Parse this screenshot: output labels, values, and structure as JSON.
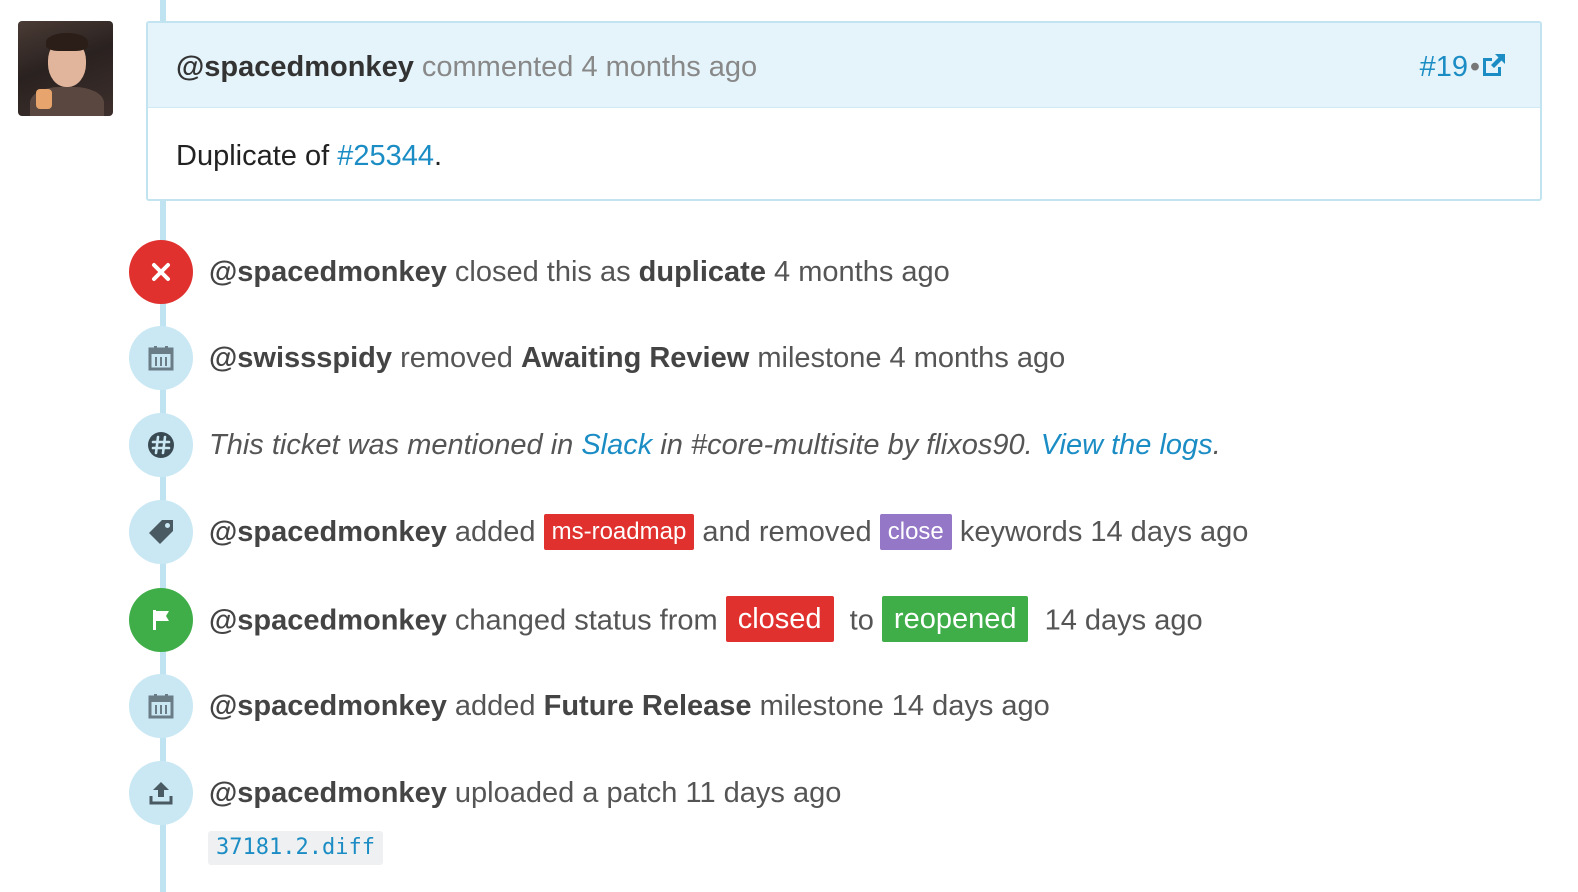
{
  "comment": {
    "author": "@spacedmonkey",
    "action": "commented 4 months ago",
    "number": "#19",
    "separator": "•",
    "body_prefix": "Duplicate of",
    "body_link": "#25344",
    "body_suffix": "."
  },
  "events": [
    {
      "icon": "close-icon",
      "parts": {
        "user": "@spacedmonkey",
        "t1": "closed this as",
        "b1": "duplicate",
        "t2": "4 months ago"
      }
    },
    {
      "icon": "calendar-icon",
      "parts": {
        "user": "@swissspidy",
        "t1": "removed",
        "b1": "Awaiting Review",
        "t2": "milestone 4 months ago"
      }
    },
    {
      "icon": "slack-icon",
      "parts": {
        "t1": "This ticket was mentioned in",
        "link1": "Slack",
        "t2": "in #core-multisite by flixos90.",
        "link2": "View the logs",
        "t3": "."
      }
    },
    {
      "icon": "tag-icon",
      "parts": {
        "user": "@spacedmonkey",
        "t1": "added",
        "tag1": "ms-roadmap",
        "t2": "and removed",
        "tag2": "close",
        "t3": "keywords 14 days ago"
      }
    },
    {
      "icon": "flag-icon",
      "parts": {
        "user": "@spacedmonkey",
        "t1": "changed status from",
        "status1": "closed",
        "t2": "to",
        "status2": "reopened",
        "t3": "14 days ago"
      }
    },
    {
      "icon": "calendar-icon",
      "parts": {
        "user": "@spacedmonkey",
        "t1": "added",
        "b1": "Future Release",
        "t2": "milestone 14 days ago"
      }
    },
    {
      "icon": "upload-icon",
      "parts": {
        "user": "@spacedmonkey",
        "t1": "uploaded a patch 11 days ago"
      }
    }
  ],
  "patch": {
    "file": "37181.2.diff"
  },
  "colors": {
    "accent": "#1b8dc4",
    "red": "#e0312f",
    "green": "#3fae49",
    "purple": "#9477c6",
    "timeline": "#bfe3f1"
  }
}
